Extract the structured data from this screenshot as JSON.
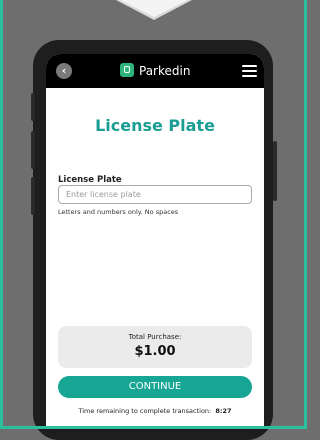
{
  "header": {
    "back_icon": "chevron-left-icon",
    "brand_name": "Parkedin",
    "logo_icon": "parkedin-logo-icon",
    "menu_icon": "hamburger-menu-icon"
  },
  "page": {
    "title": "License Plate"
  },
  "form": {
    "field_label": "License Plate",
    "plate_value": "",
    "plate_placeholder": "Enter license plate",
    "hint": "Letters and numbers only. No spaces"
  },
  "summary": {
    "total_label": "Total Purchase:",
    "total_amount": "$1.00"
  },
  "actions": {
    "continue_label": "CONTINUE"
  },
  "timer": {
    "label": "Time remaining to complete transaction:",
    "value": "8:27"
  },
  "colors": {
    "accent": "#17a594",
    "title": "#1a9d93",
    "brand_logo": "#2eb37a",
    "frame_border": "#2bbf9b"
  }
}
